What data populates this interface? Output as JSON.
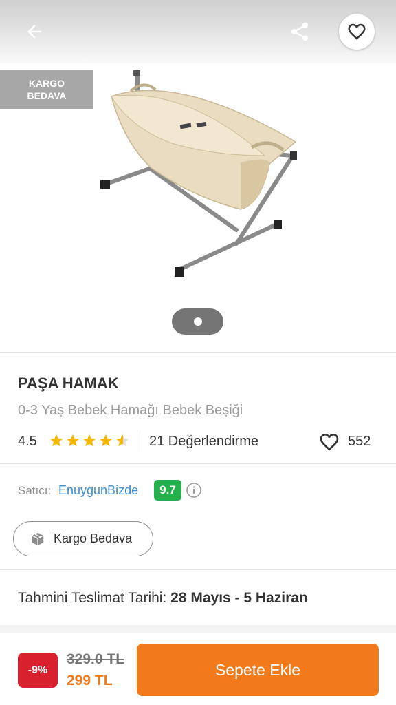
{
  "header": {
    "back_icon": "arrow-left-icon",
    "share_icon": "share-icon",
    "favorite_icon": "heart-outline-icon"
  },
  "gallery": {
    "badge": "KARGO\nBEDAVA",
    "current_page": 1,
    "total_pages": 1
  },
  "product": {
    "brand": "PAŞA HAMAK",
    "name": "0-3 Yaş Bebek Hamağı Bebek Beşiği",
    "rating": "4.5",
    "rating_value": 4.5,
    "reviews": "21 Değerlendirme",
    "likes": "552"
  },
  "seller": {
    "label": "Satıcı:",
    "name": "EnuygunBizde",
    "score": "9.7"
  },
  "shipping_chip": {
    "label": "Kargo Bedava",
    "icon": "package-icon"
  },
  "delivery": {
    "label": "Tahmini Teslimat Tarihi:",
    "value": "28 Mayıs - 5 Haziran"
  },
  "pricing": {
    "discount": "-9%",
    "old_price": "329.0 TL",
    "new_price": "299 TL",
    "button": "Sepete Ekle"
  },
  "colors": {
    "accent": "#f27a1a",
    "discount": "#d9202e",
    "seller_score": "#22b14c",
    "seller_link": "#3e8fd6",
    "star": "#f5b800"
  }
}
